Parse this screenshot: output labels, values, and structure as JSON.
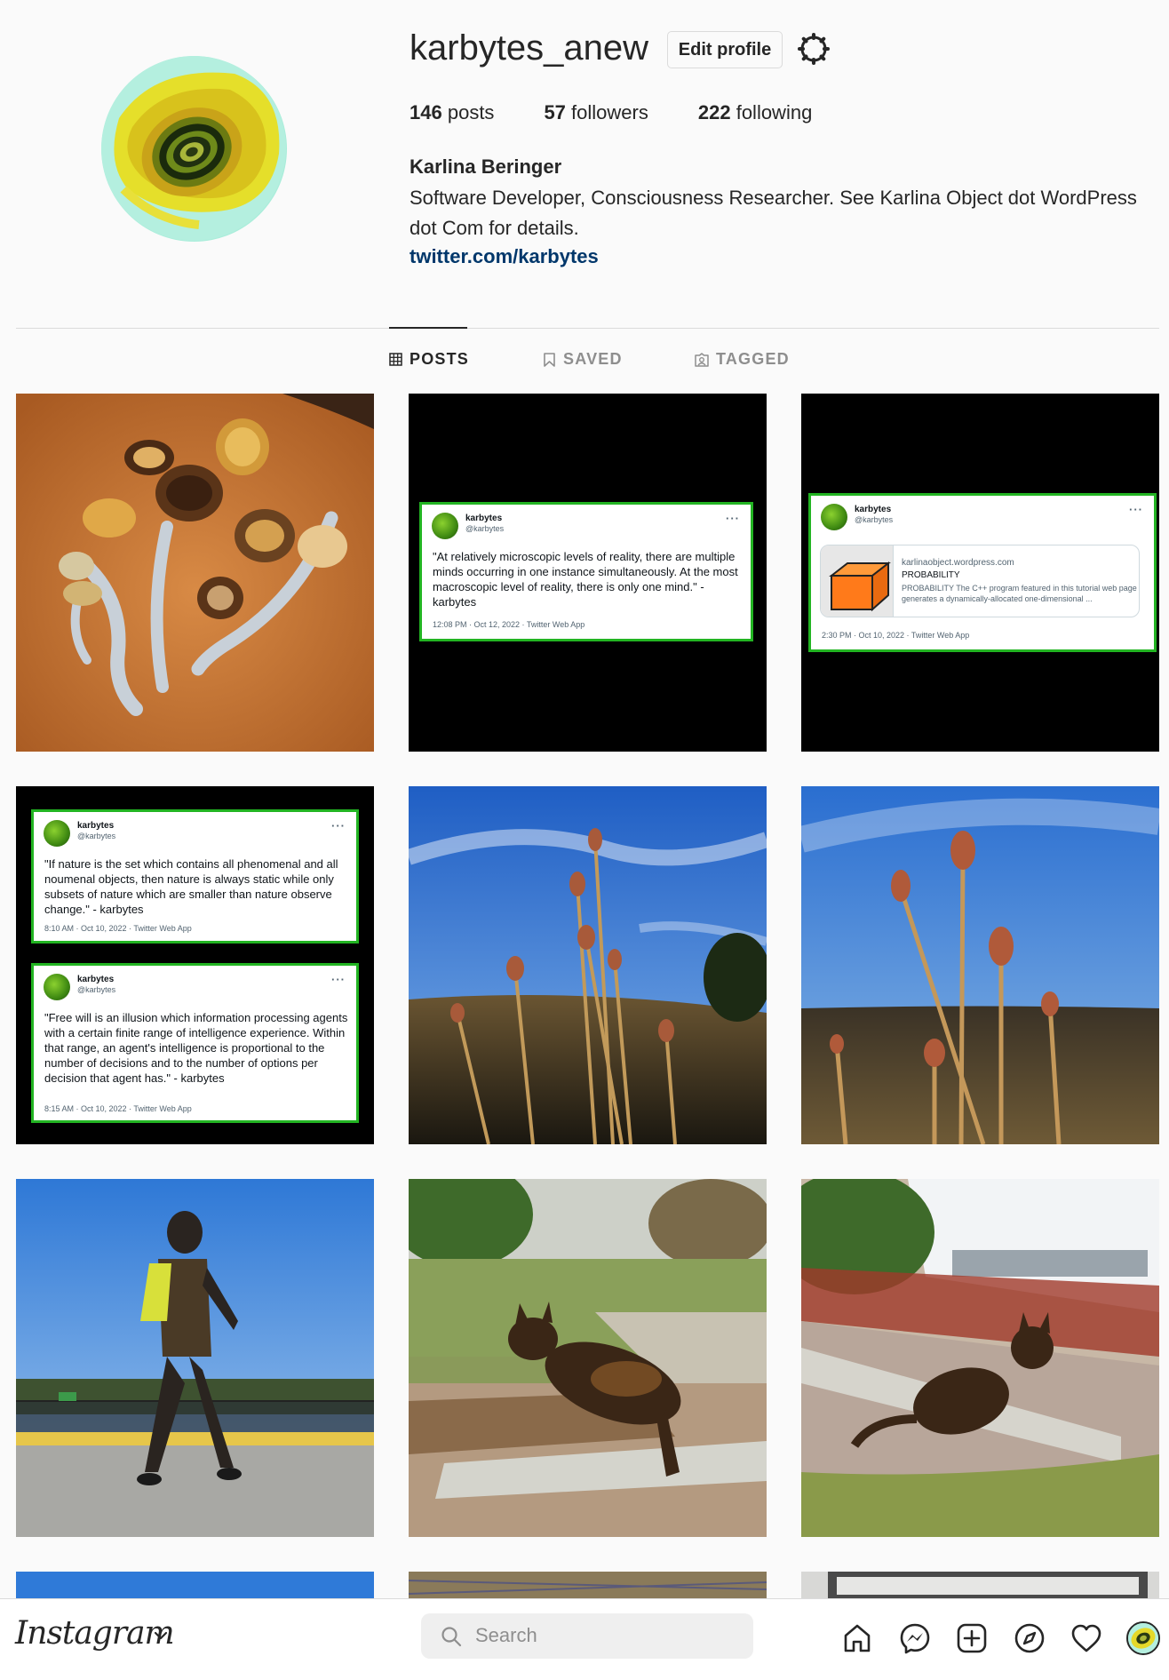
{
  "profile": {
    "username": "karbytes_anew",
    "edit_label": "Edit profile",
    "posts_count": "146",
    "posts_label": "posts",
    "followers_count": "57",
    "followers_label": "followers",
    "following_count": "222",
    "following_label": "following",
    "full_name": "Karlina Beringer",
    "bio": "Software Developer, Consciousness Researcher. See Karlina Object dot WordPress dot Com for details.",
    "link": "twitter.com/karbytes"
  },
  "tabs": [
    {
      "label": "POSTS",
      "icon": "grid-icon",
      "active": true
    },
    {
      "label": "SAVED",
      "icon": "bookmark-icon",
      "active": false
    },
    {
      "label": "TAGGED",
      "icon": "tagged-icon",
      "active": false
    }
  ],
  "tweets": {
    "t1": {
      "name": "karbytes",
      "handle": "@karbytes",
      "text": "\"At relatively microscopic levels of reality, there are multiple minds occurring in one instance simultaneously. At the most macroscopic level of reality, there is only one mind.\" - karbytes",
      "meta": "12:08 PM · Oct 12, 2022 · Twitter Web App"
    },
    "t2": {
      "name": "karbytes",
      "handle": "@karbytes",
      "link_domain": "karlinaobject.wordpress.com",
      "link_title": "PROBABILITY",
      "link_desc": "PROBABILITY The C++ program featured in this tutorial web page generates a dynamically-allocated one-dimensional ...",
      "meta": "2:30 PM · Oct 10, 2022 · Twitter Web App"
    },
    "t3": {
      "name": "karbytes",
      "handle": "@karbytes",
      "text": "\"If nature is the set which contains all phenomenal and all noumenal objects, then nature is always static while only subsets of nature which are smaller than nature observe change.\" - karbytes",
      "meta": "8:10 AM · Oct 10, 2022 · Twitter Web App"
    },
    "t4": {
      "name": "karbytes",
      "handle": "@karbytes",
      "text": "\"Free will is an illusion which information processing agents with a certain finite range of intelligence experience. Within that range, an agent's intelligence is proportional to the number of decisions and to the number of options per decision that agent has.\" - karbytes",
      "meta": "8:15 AM · Oct 10, 2022 · Twitter Web App"
    }
  },
  "bottom_bar": {
    "logo": "Instagram",
    "search_placeholder": "Search",
    "icons": [
      "home-icon",
      "messenger-icon",
      "new-post-icon",
      "explore-icon",
      "activity-heart-icon",
      "profile-avatar"
    ]
  },
  "colors": {
    "link": "#00376b",
    "tweet_border": "#22b422",
    "text": "#262626",
    "muted": "#8e8e8e"
  }
}
